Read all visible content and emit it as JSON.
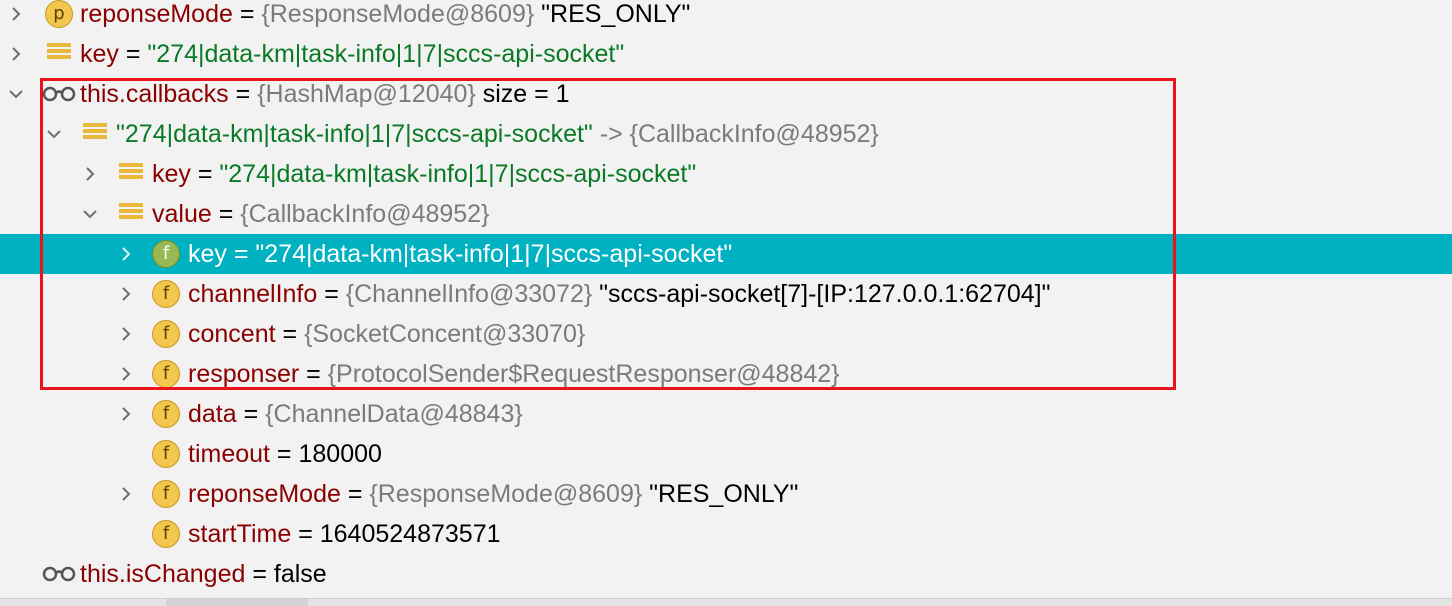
{
  "rows": [
    {
      "name": "reponseMode",
      "eq": " = ",
      "ref": "{ResponseMode@8609}",
      "extra": " \"RES_ONLY\"",
      "str": ""
    },
    {
      "name": "key",
      "eq": " = ",
      "ref": "",
      "extra": "",
      "str": "\"274|data-km|task-info|1|7|sccs-api-socket\""
    },
    {
      "name": "this.callbacks",
      "eq": " = ",
      "ref": "{HashMap@12040}",
      "extra": "  size = 1",
      "str": ""
    },
    {
      "name": "",
      "eq": "",
      "ref": " -> {CallbackInfo@48952}",
      "extra": "",
      "str": "\"274|data-km|task-info|1|7|sccs-api-socket\""
    },
    {
      "name": "key",
      "eq": " = ",
      "ref": "",
      "extra": "",
      "str": "\"274|data-km|task-info|1|7|sccs-api-socket\""
    },
    {
      "name": "value",
      "eq": " = ",
      "ref": "{CallbackInfo@48952}",
      "extra": "",
      "str": ""
    },
    {
      "name": "key",
      "eq": " = ",
      "ref": "",
      "extra": "",
      "str": "\"274|data-km|task-info|1|7|sccs-api-socket\""
    },
    {
      "name": "channelInfo",
      "eq": " = ",
      "ref": "{ChannelInfo@33072}",
      "extra": " \"sccs-api-socket[7]-[IP:127.0.0.1:62704]\"",
      "str": ""
    },
    {
      "name": "concent",
      "eq": " = ",
      "ref": "{SocketConcent@33070}",
      "extra": "",
      "str": ""
    },
    {
      "name": "responser",
      "eq": " = ",
      "ref": "{ProtocolSender$RequestResponser@48842}",
      "extra": "",
      "str": ""
    },
    {
      "name": "data",
      "eq": " = ",
      "ref": "{ChannelData@48843}",
      "extra": "",
      "str": ""
    },
    {
      "name": "timeout",
      "eq": " = ",
      "ref": "",
      "extra": "180000",
      "str": ""
    },
    {
      "name": "reponseMode",
      "eq": " = ",
      "ref": "{ResponseMode@8609}",
      "extra": " \"RES_ONLY\"",
      "str": ""
    },
    {
      "name": "startTime",
      "eq": " = ",
      "ref": "",
      "extra": "1640524873571",
      "str": ""
    },
    {
      "name": "this.isChanged",
      "eq": " = ",
      "ref": "",
      "extra": "false",
      "str": ""
    }
  ],
  "icons": {
    "p_letter": "p",
    "f_letter": "f"
  },
  "colors": {
    "selection": "#00b1c1",
    "highlight_box": "#e8131b",
    "field_name": "#8b0000",
    "string_value": "#0a7a26",
    "reference": "#7b7b7b",
    "icon_yellow": "#f3c64e",
    "icon_green": "#98b854"
  }
}
